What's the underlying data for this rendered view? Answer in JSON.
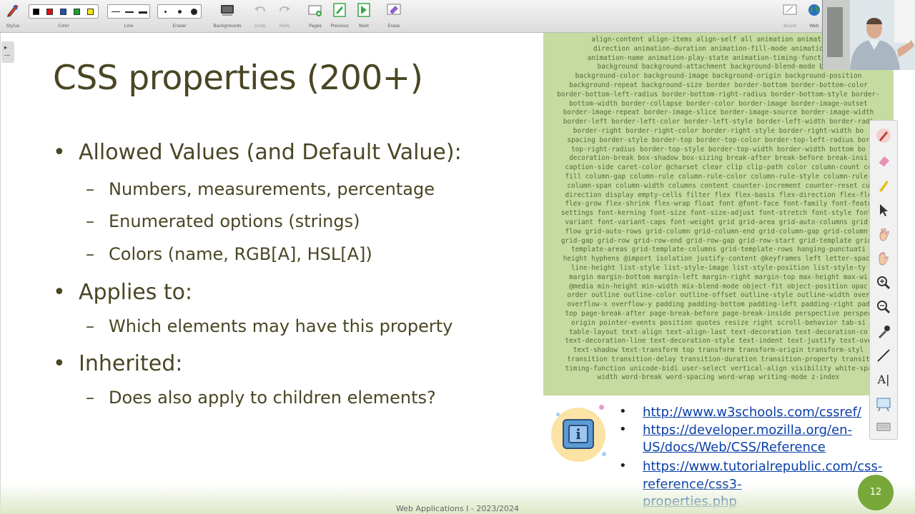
{
  "toolbar": {
    "groups": [
      {
        "name": "stylus",
        "label": "Stylus"
      },
      {
        "name": "color",
        "label": "Color"
      },
      {
        "name": "line",
        "label": "Line"
      },
      {
        "name": "eraser",
        "label": "Eraser"
      },
      {
        "name": "backgrounds",
        "label": "Backgrounds"
      },
      {
        "name": "undo",
        "label": "Undo"
      },
      {
        "name": "redo",
        "label": "Redo"
      },
      {
        "name": "pages",
        "label": "Pages"
      },
      {
        "name": "previous",
        "label": "Previous"
      },
      {
        "name": "next",
        "label": "Next"
      },
      {
        "name": "erase",
        "label": "Erase"
      },
      {
        "name": "board",
        "label": "Board"
      },
      {
        "name": "web",
        "label": "Web"
      }
    ],
    "colors": [
      "#000000",
      "#e01010",
      "#1f4fb5",
      "#20a030",
      "#f2e21a"
    ]
  },
  "slide": {
    "title": "CSS properties (200+)",
    "bullets": [
      {
        "level": 1,
        "mark": "•",
        "text": "Allowed Values (and Default Value):"
      },
      {
        "level": 2,
        "mark": "–",
        "text": "Numbers, measurements, percentage"
      },
      {
        "level": 2,
        "mark": "–",
        "text": "Enumerated options (strings)"
      },
      {
        "level": 2,
        "mark": "–",
        "text": "Colors (name, RGB[A], HSL[A])"
      },
      {
        "level": 1,
        "mark": "•",
        "text": "Applies to:"
      },
      {
        "level": 2,
        "mark": "–",
        "text": "Which elements may have this property"
      },
      {
        "level": 1,
        "mark": "•",
        "text": "Inherited:"
      },
      {
        "level": 2,
        "mark": "–",
        "text": "Does also apply to children elements?"
      }
    ],
    "property_lines": [
      "align-content align-items align-self all animation animation-de",
      "direction animation-duration animation-fill-mode animation-ite",
      "animation-name animation-play-state animation-timing-function bac",
      "background background-attachment background-blend-mode backg",
      "background-color background-image background-origin background-position",
      "background-repeat background-size border border-bottom border-bottom-color",
      "border-bottom-left-radius border-bottom-right-radius border-bottom-style border-",
      "bottom-width border-collapse border-color border-image border-image-outset",
      "border-image-repeat border-image-slice border-image-source border-image-width",
      "border-left border-left-color border-left-style border-left-width border-radi",
      "border-right border-right-color border-right-style border-right-width bo",
      "spacing border-style border-top border-top-color border-top-left-radius bor",
      "top-right-radius border-top-style border-top-width border-width bottom bo",
      "decoration-break box-shadow box-sizing break-after break-before break-insi",
      "caption-side caret-color @charset clear clip clip-path color column-count co",
      "fill column-gap column-rule column-rule-color column-rule-style column-rule-",
      "column-span column-width columns content counter-increment counter-reset cu",
      "direction display empty-cells filter flex flex-basis flex-direction flex-flo",
      "flex-grow flex-shrink flex-wrap float font @font-face font-family font-featu",
      "settings font-kerning font-size font-size-adjust font-stretch font-style font-",
      "variant font-variant-caps font-weight grid grid-area grid-auto-columns grid-",
      "flow grid-auto-rows grid-column grid-column-end grid-column-gap grid-column-",
      "grid-gap grid-row grid-row-end grid-row-gap grid-row-start grid-template grid-",
      "template-areas grid-template-columns grid-template-rows hanging-punctuati",
      "height hyphens @import isolation justify-content @keyframes left letter-spaci",
      "line-height list-style list-style-image list-style-position list-style-ty",
      "margin margin-bottom margin-left margin-right margin-top max-height max-wi",
      "@media min-height min-width mix-blend-mode object-fit object-position opac",
      "order outline outline-color outline-offset outline-style outline-width over",
      "overflow-x overflow-y padding padding-bottom padding-left padding-right pad",
      "top page-break-after page-break-before page-break-inside perspective perspec",
      "origin pointer-events position quotes resize right scroll-behavior tab-si",
      "table-layout text-align text-align-last text-decoration text-decoration-co",
      "text-decoration-line text-decoration-style text-indent text-justify text-ove",
      "text-shadow text-transform top transform transform-origin transform-styl",
      "transition transition-delay transition-duration transition-property transit",
      "timing-function unicode-bidi user-select vertical-align visibility white-spa",
      "width word-break word-spacing word-wrap writing-mode z-index"
    ],
    "links": [
      {
        "mark": "•",
        "lines": [
          "http://www.w3schools.com/cssref/"
        ]
      },
      {
        "mark": "•",
        "lines": [
          "https://developer.mozilla.org/en-",
          "US/docs/Web/CSS/Reference"
        ]
      },
      {
        "mark": "•",
        "lines": [
          "https://www.tutorialrepublic.com/css-",
          "reference/css3-properties.php"
        ]
      }
    ],
    "info_glyph": "i",
    "footer": "Web Applications I - 2023/2024",
    "page_number": "12"
  },
  "annotation_tools": [
    "pen-icon",
    "eraser-icon",
    "highlighter-icon",
    "pointer-icon",
    "hand-icon",
    "grab-icon",
    "zoom-in-icon",
    "zoom-out-icon",
    "color-picker-icon",
    "line-icon",
    "text-icon",
    "whiteboard-icon",
    "keyboard-icon"
  ],
  "annotation_text_glyph": "A|",
  "thumbnail_toggle": "▸"
}
